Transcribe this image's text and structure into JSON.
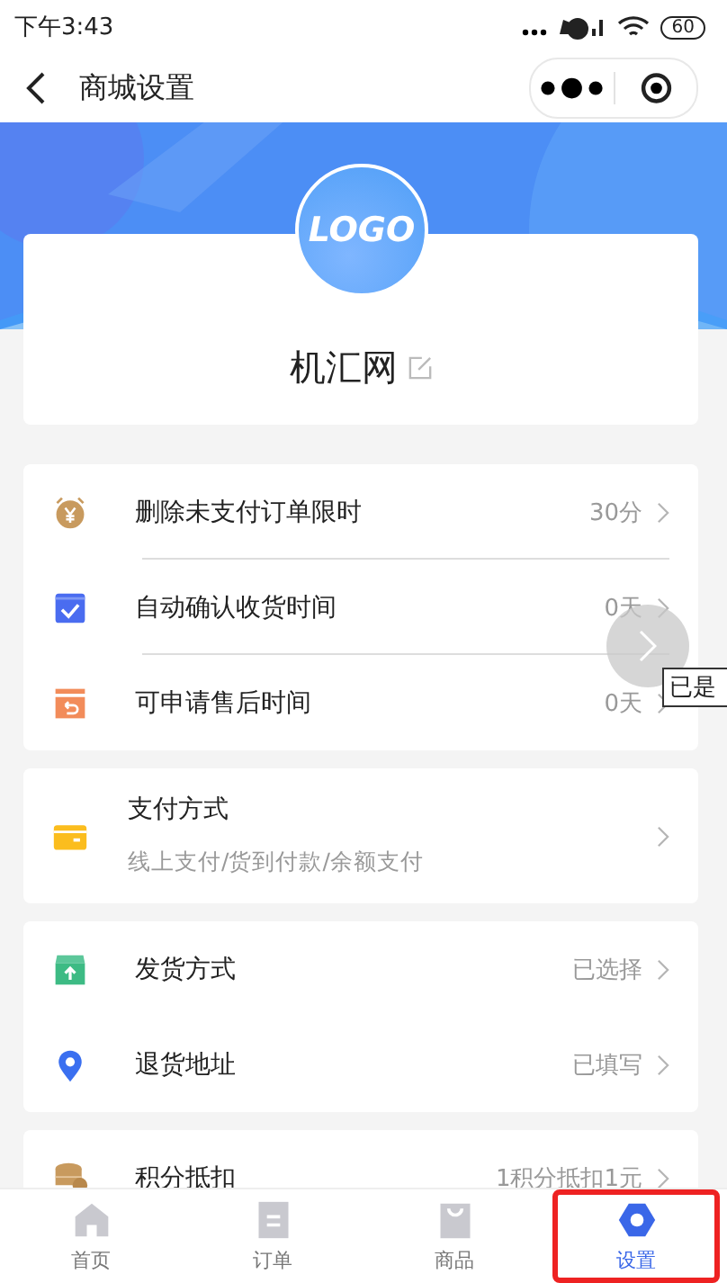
{
  "status_bar": {
    "time": "下午3:43",
    "battery": "60"
  },
  "nav_bar": {
    "title": "商城设置"
  },
  "shop": {
    "logo_text": "LOGO",
    "name": "机汇网"
  },
  "groups": [
    {
      "items": [
        {
          "kind": "alarm",
          "label": "删除未支付订单限时",
          "value": "30分"
        },
        {
          "kind": "check",
          "label": "自动确认收货时间",
          "value": "0天"
        },
        {
          "kind": "return",
          "label": "可申请售后时间",
          "value": "0天"
        }
      ]
    },
    {
      "items": [
        {
          "kind": "card",
          "label": "支付方式",
          "subtitle": "线上支付/货到付款/余额支付"
        }
      ]
    },
    {
      "items": [
        {
          "kind": "box",
          "label": "发货方式",
          "value": "已选择"
        },
        {
          "kind": "pin",
          "label": "退货地址",
          "value": "已填写"
        }
      ]
    },
    {
      "items": [
        {
          "kind": "coins",
          "label": "积分抵扣",
          "value": "1积分抵扣1元"
        }
      ]
    }
  ],
  "tooltip": "已是",
  "tabs": [
    {
      "kind": "home",
      "label": "首页",
      "selected": false,
      "outlined": false
    },
    {
      "kind": "order",
      "label": "订单",
      "selected": false,
      "outlined": false
    },
    {
      "kind": "bag",
      "label": "商品",
      "selected": false,
      "outlined": false
    },
    {
      "kind": "hex",
      "label": "设置",
      "selected": true,
      "outlined": true
    }
  ]
}
